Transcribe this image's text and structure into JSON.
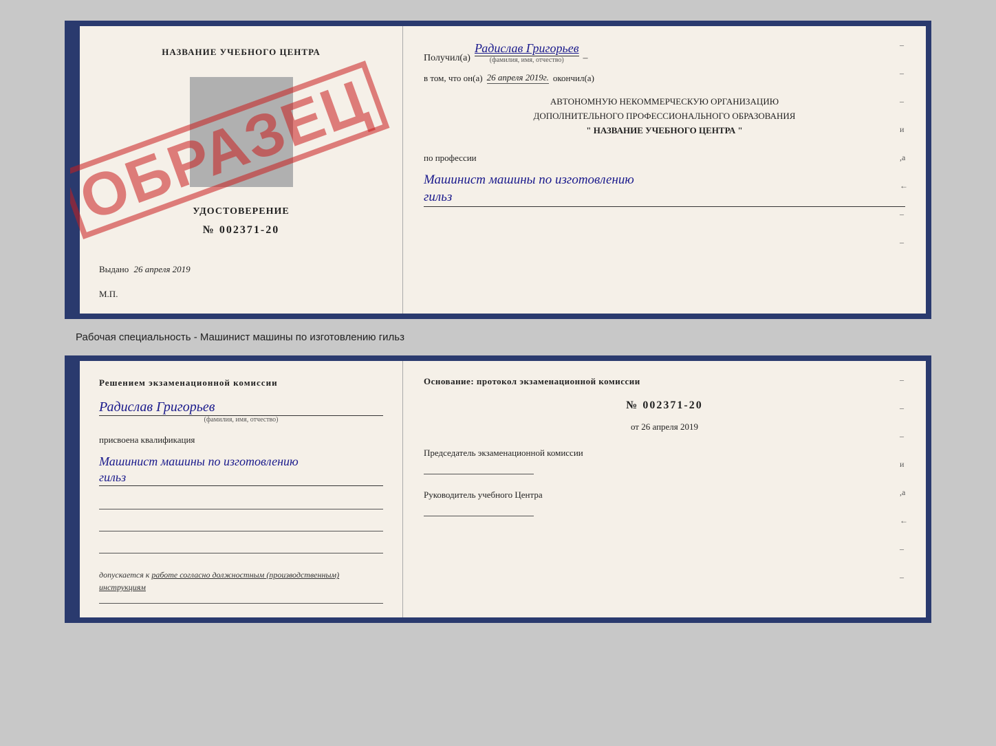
{
  "top": {
    "left": {
      "center_title": "НАЗВАНИЕ УЧЕБНОГО ЦЕНТРА",
      "cert_label": "УДОСТОВЕРЕНИЕ",
      "cert_number": "№ 002371-20",
      "issued_line": "Выдано",
      "issued_date": "26 апреля 2019",
      "mp_label": "М.П.",
      "stamp_text": "ОБРАЗЕЦ"
    },
    "right": {
      "received_prefix": "Получил(а)",
      "recipient_name": "Радислав Григорьев",
      "fio_hint": "(фамилия, имя, отчество)",
      "dash": "–",
      "date_prefix": "в том, что он(а)",
      "date_value": "26 апреля 2019г.",
      "finished_suffix": "окончил(а)",
      "org_line1": "АВТОНОМНУЮ НЕКОММЕРЧЕСКУЮ ОРГАНИЗАЦИЮ",
      "org_line2": "ДОПОЛНИТЕЛЬНОГО ПРОФЕССИОНАЛЬНОГО ОБРАЗОВАНИЯ",
      "org_name": "\"  НАЗВАНИЕ УЧЕБНОГО ЦЕНТРА  \"",
      "profession_label": "по профессии",
      "profession_value": "Машинист машины по изготовлению",
      "profession_value2": "гильз"
    },
    "dashes": [
      "-",
      "-",
      "-",
      "и",
      ",а",
      "←",
      "-",
      "-"
    ]
  },
  "middle_label": "Рабочая специальность - Машинист машины по изготовлению гильз",
  "bottom": {
    "left": {
      "resolution_title": "Решением  экзаменационной  комиссии",
      "name": "Радислав Григорьев",
      "fio_hint": "(фамилия, имя, отчество)",
      "assigned_label": "присвоена квалификация",
      "qualification_line1": "Машинист машины по изготовлению",
      "qualification_line2": "гильз",
      "allowed_label": "допускается к",
      "allowed_value": "работе согласно должностным (производственным) инструкциям"
    },
    "right": {
      "basis_label": "Основание: протокол экзаменационной  комиссии",
      "protocol_number": "№  002371-20",
      "protocol_date_prefix": "от",
      "protocol_date": "26 апреля 2019",
      "chairman_label": "Председатель экзаменационной комиссии",
      "director_label": "Руководитель учебного Центра"
    },
    "dashes": [
      "-",
      "-",
      "-",
      "и",
      ",а",
      "←",
      "-",
      "-"
    ]
  }
}
